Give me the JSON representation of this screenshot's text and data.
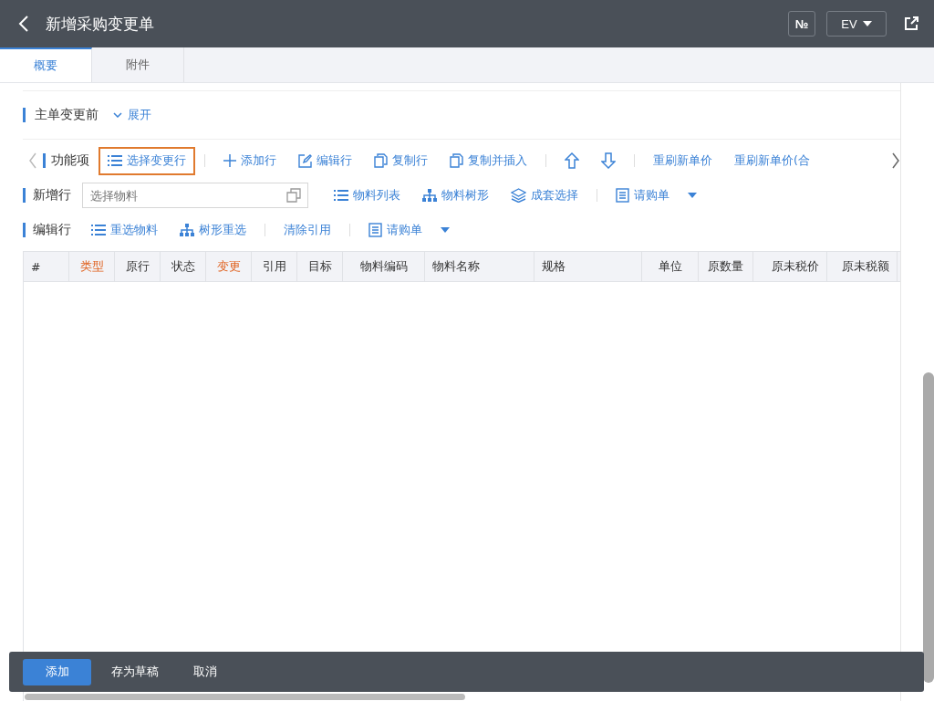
{
  "header": {
    "title": "新增采购变更单",
    "no_button": "№",
    "lang_button": "EV"
  },
  "tabs": [
    {
      "label": "概要",
      "selected": true
    },
    {
      "label": "附件",
      "selected": false
    }
  ],
  "section": {
    "title": "主单变更前",
    "toggle": "展开"
  },
  "function_bar": {
    "label": "功能项",
    "items": [
      {
        "kind": "list",
        "label": "选择变更行",
        "selected": true
      },
      {
        "kind": "divider"
      },
      {
        "kind": "plus",
        "label": "添加行",
        "selected": false
      },
      {
        "kind": "edit",
        "label": "编辑行",
        "selected": false
      },
      {
        "kind": "copy",
        "label": "复制行",
        "selected": false
      },
      {
        "kind": "copy",
        "label": "复制并插入",
        "selected": false
      },
      {
        "kind": "divider"
      },
      {
        "kind": "up",
        "selected": false
      },
      {
        "kind": "down",
        "selected": false
      },
      {
        "kind": "divider"
      },
      {
        "kind": "text",
        "label": "重刷新单价",
        "selected": false
      },
      {
        "kind": "text",
        "label": "重刷新单价(合",
        "selected": false
      }
    ]
  },
  "add_bar": {
    "label": "新增行",
    "placeholder": "选择物料",
    "items": [
      {
        "kind": "list",
        "label": "物料列表"
      },
      {
        "kind": "tree",
        "label": "物料树形"
      },
      {
        "kind": "layers",
        "label": "成套选择"
      },
      {
        "kind": "divider"
      },
      {
        "kind": "doc",
        "label": "请购单"
      },
      {
        "kind": "caret"
      }
    ]
  },
  "edit_bar": {
    "label": "编辑行",
    "items": [
      {
        "kind": "list",
        "label": "重选物料"
      },
      {
        "kind": "tree",
        "label": "树形重选"
      },
      {
        "kind": "divider"
      },
      {
        "kind": "text",
        "label": "清除引用"
      },
      {
        "kind": "divider"
      },
      {
        "kind": "doc",
        "label": "请购单"
      },
      {
        "kind": "caret"
      }
    ]
  },
  "table": {
    "columns": [
      {
        "label": "#",
        "required": false
      },
      {
        "label": "类型",
        "required": true
      },
      {
        "label": "原行",
        "required": false
      },
      {
        "label": "状态",
        "required": false
      },
      {
        "label": "变更",
        "required": true
      },
      {
        "label": "引用",
        "required": false
      },
      {
        "label": "目标",
        "required": false
      },
      {
        "label": "物料编码",
        "required": false
      },
      {
        "label": "物料名称",
        "required": false
      },
      {
        "label": "规格",
        "required": false
      },
      {
        "label": "单位",
        "required": false
      },
      {
        "label": "原数量",
        "required": false
      },
      {
        "label": "原未税价",
        "required": false
      },
      {
        "label": "原未税额",
        "required": false
      }
    ]
  },
  "footer": {
    "buttons": [
      {
        "label": "添加",
        "primary": true
      },
      {
        "label": "存为草稿",
        "primary": false
      },
      {
        "label": "取消",
        "primary": false
      }
    ]
  }
}
